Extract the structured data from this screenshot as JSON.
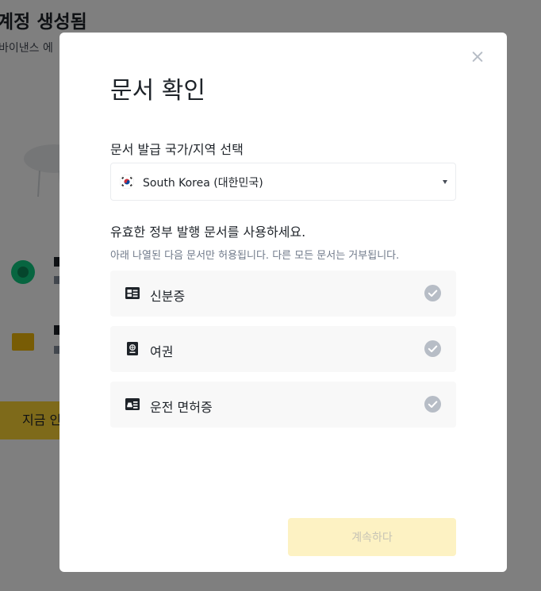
{
  "background": {
    "title": "계정 생성됨",
    "subtitle": "바이낸스 에",
    "button_label": "지금 인"
  },
  "modal": {
    "title": "문서 확인",
    "country": {
      "label": "문서 발급 국가/지역 선택",
      "selected": "South Korea (대한민국)",
      "flag_icon": "south-korea-flag-icon"
    },
    "documents_heading": "유효한 정부 발행 문서를 사용하세요.",
    "documents_subtitle": "아래 나열된 다음 문서만 허용됩니다. 다른 모든 문서는 거부됩니다.",
    "documents": [
      {
        "label": "신분증",
        "icon": "id-card-icon"
      },
      {
        "label": "여권",
        "icon": "passport-icon"
      },
      {
        "label": "운전 면허증",
        "icon": "driver-license-icon"
      }
    ],
    "continue_label": "계속하다"
  },
  "colors": {
    "accent": "#fcd535",
    "accent_disabled": "#fdf2c3",
    "text_primary": "#1e2329",
    "text_secondary": "#707a8a",
    "option_bg": "#f8f8f8",
    "check_gray": "#b7bdc6"
  }
}
